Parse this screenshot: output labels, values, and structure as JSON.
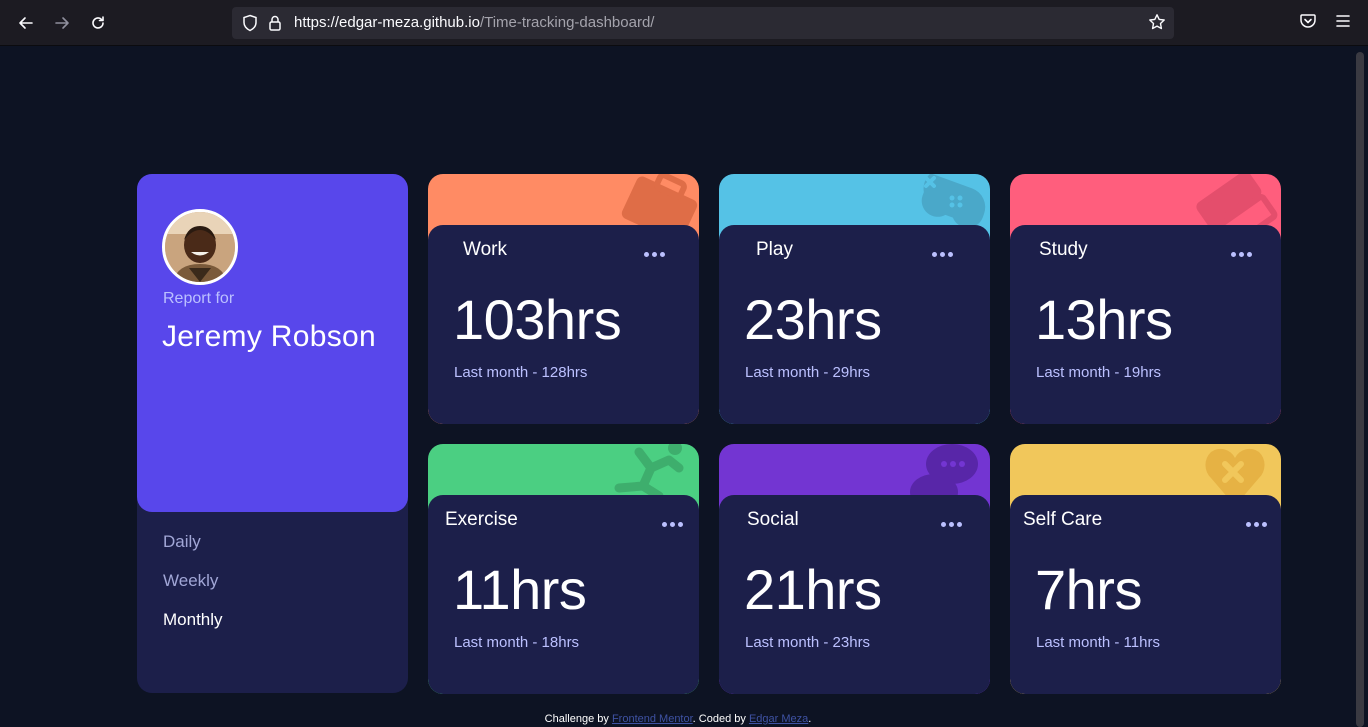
{
  "browser": {
    "url_host": "https://edgar-meza.github.io",
    "url_path": "/Time-tracking-dashboard/"
  },
  "profile": {
    "report_label": "Report for",
    "name": "Jeremy Robson",
    "avatar_icon": "user-avatar-photo"
  },
  "periods": [
    "Daily",
    "Weekly",
    "Monthly"
  ],
  "active_period": "Monthly",
  "activities": [
    {
      "title": "Work",
      "current": "103hrs",
      "previous": "Last month - 128hrs",
      "color": "#ff8b64",
      "icon": "briefcase-icon"
    },
    {
      "title": "Play",
      "current": "23hrs",
      "previous": "Last month - 29hrs",
      "color": "#55c2e6",
      "icon": "gamepad-icon"
    },
    {
      "title": "Study",
      "current": "13hrs",
      "previous": "Last month - 19hrs",
      "color": "#ff5e7d",
      "icon": "books-icon"
    },
    {
      "title": "Exercise",
      "current": "11hrs",
      "previous": "Last month - 18hrs",
      "color": "#4bcf82",
      "icon": "runner-icon"
    },
    {
      "title": "Social",
      "current": "21hrs",
      "previous": "Last month - 23hrs",
      "color": "#7335d2",
      "icon": "chat-bubble-icon"
    },
    {
      "title": "Self Care",
      "current": "7hrs",
      "previous": "Last month - 11hrs",
      "color": "#f1c75b",
      "icon": "heart-bandage-icon"
    }
  ],
  "footer": {
    "prefix": "Challenge by",
    "mentor_link": "Frontend Mentor",
    "middle": ". Coded by",
    "author_link": "Edgar Meza",
    "suffix": "."
  }
}
